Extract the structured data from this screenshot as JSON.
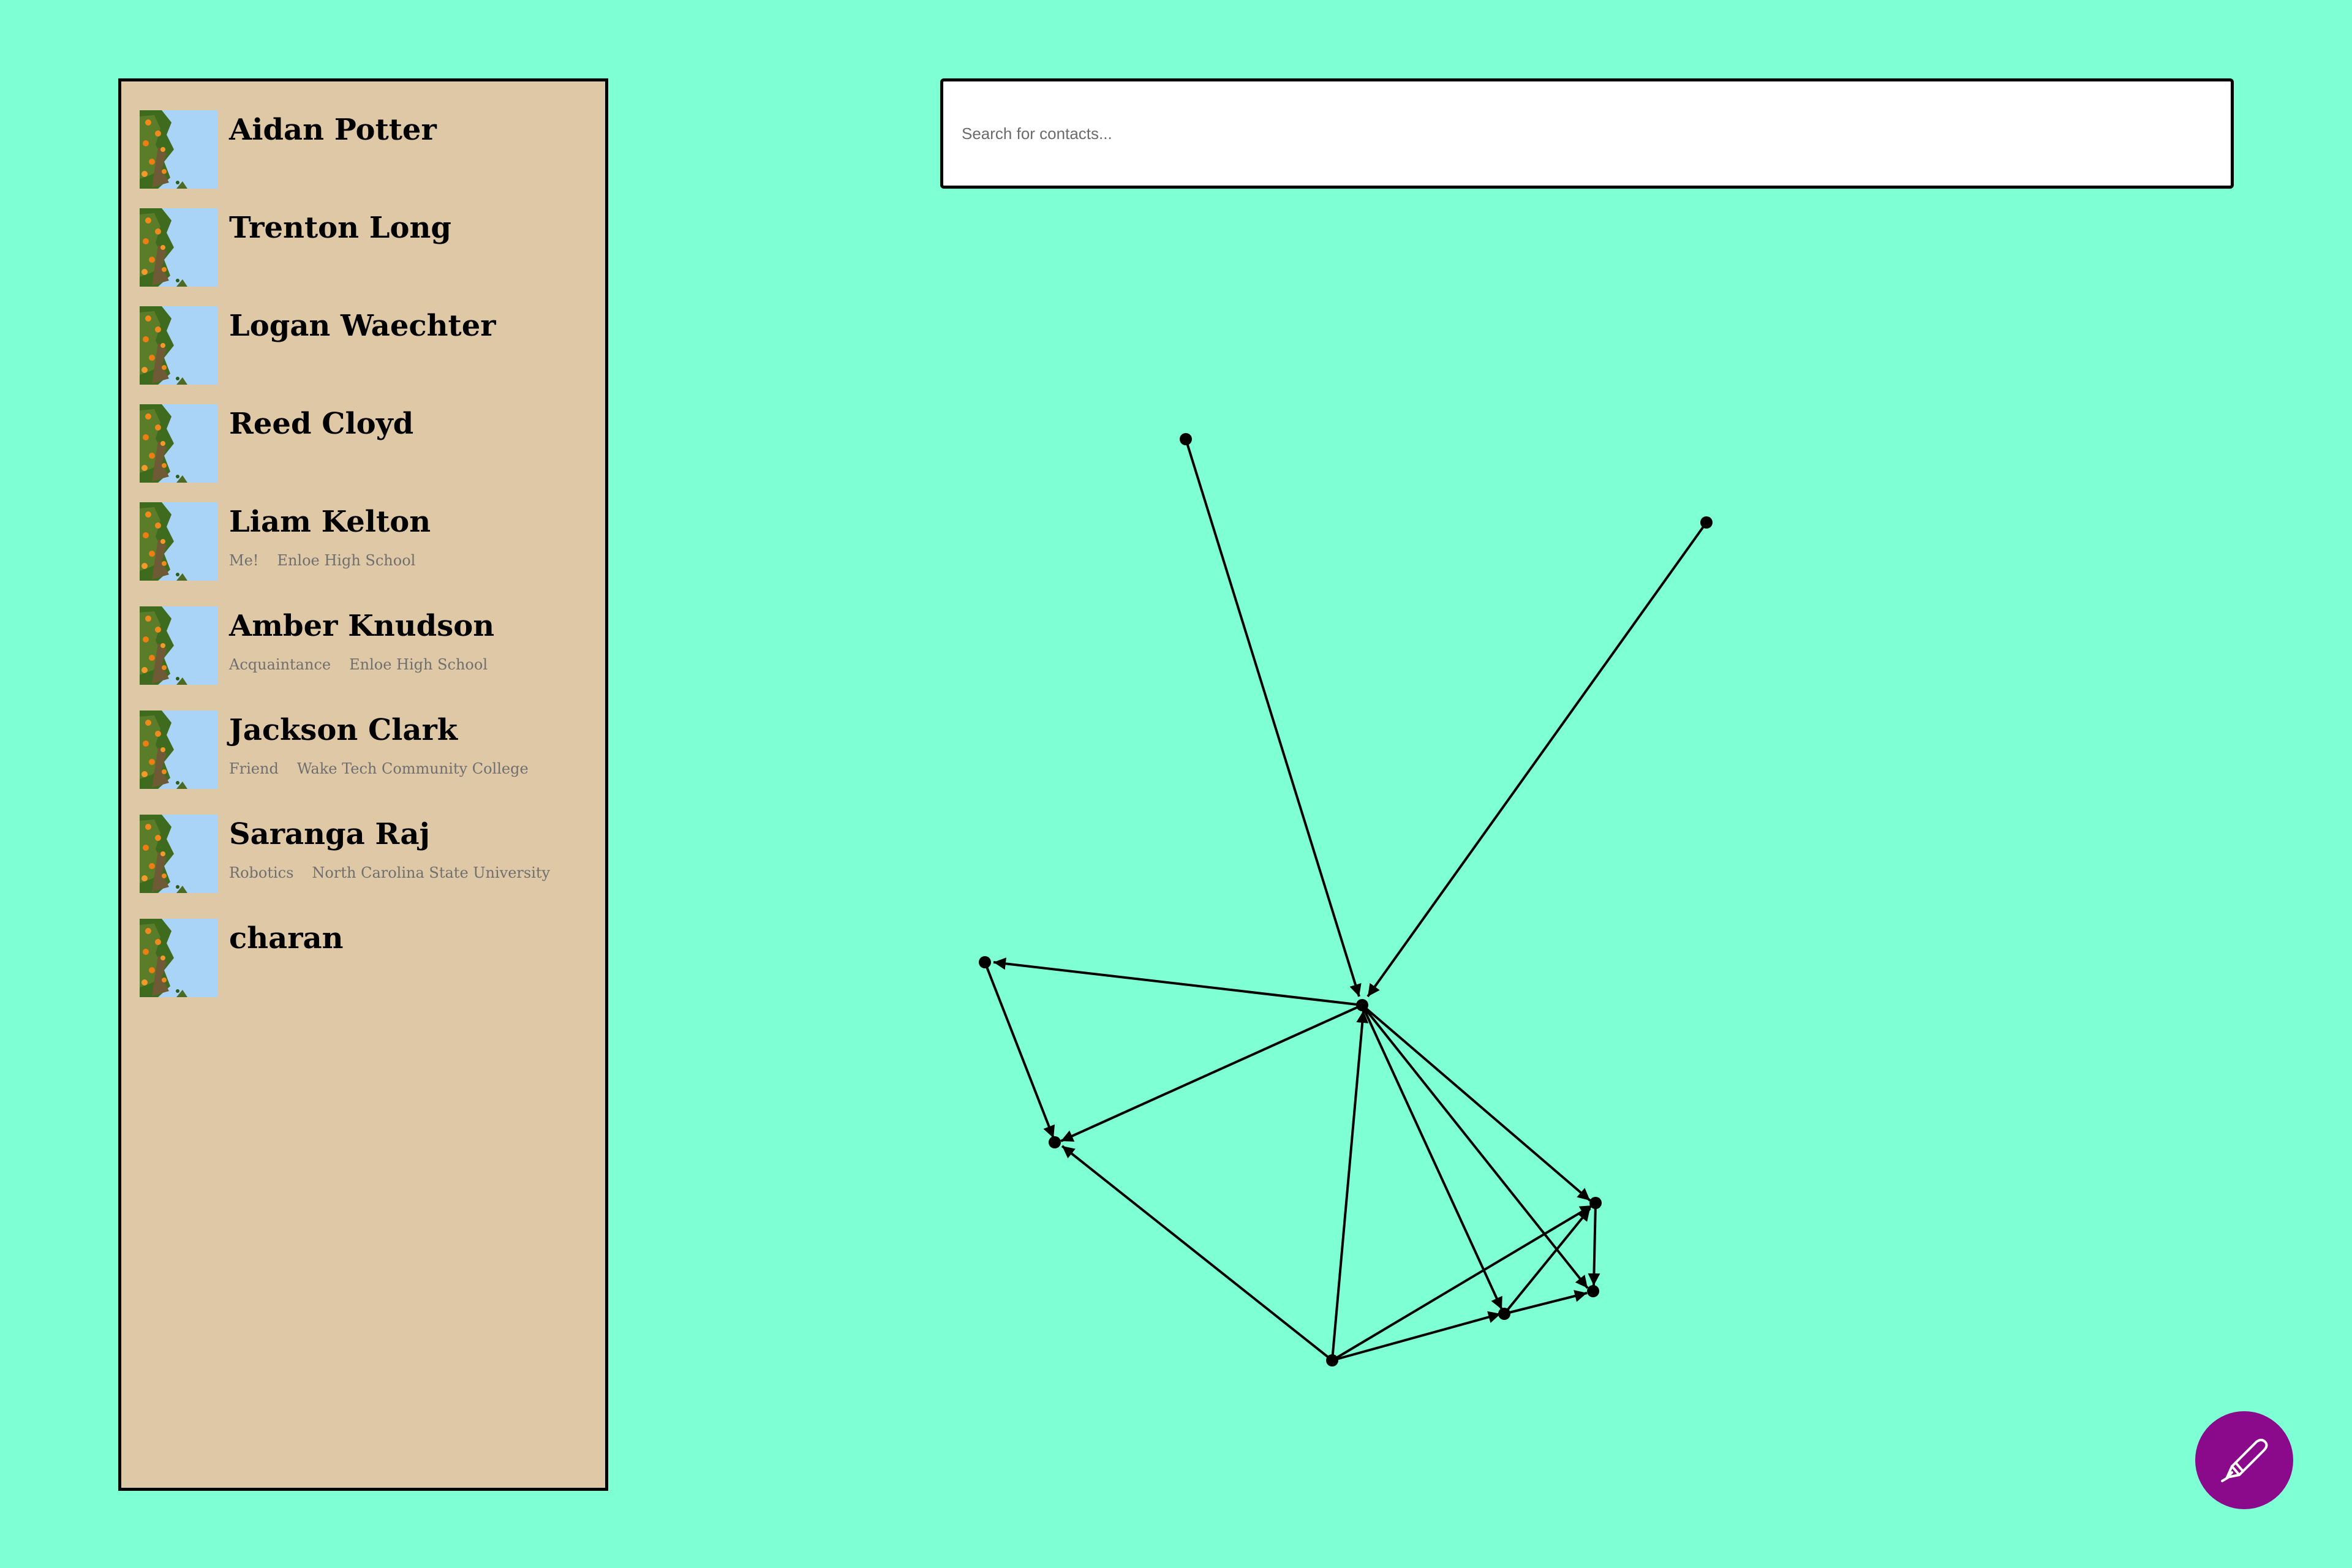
{
  "search": {
    "placeholder": "Search for contacts..."
  },
  "colors": {
    "background": "#7fffd4",
    "sidebar": "#dfc8a6",
    "fab": "#8b0a8b"
  },
  "contacts": [
    {
      "name": "Aidan Potter",
      "relation": "",
      "organization": ""
    },
    {
      "name": "Trenton Long",
      "relation": "",
      "organization": ""
    },
    {
      "name": "Logan Waechter",
      "relation": "",
      "organization": ""
    },
    {
      "name": "Reed Cloyd",
      "relation": "",
      "organization": ""
    },
    {
      "name": "Liam Kelton",
      "relation": "Me!",
      "organization": "Enloe High School"
    },
    {
      "name": "Amber Knudson",
      "relation": "Acquaintance",
      "organization": "Enloe High School"
    },
    {
      "name": "Jackson Clark",
      "relation": "Friend",
      "organization": "Wake Tech Community College"
    },
    {
      "name": "Saranga Raj",
      "relation": "Robotics",
      "organization": "North Carolina State University"
    },
    {
      "name": "charan",
      "relation": "",
      "organization": ""
    }
  ],
  "fab": {
    "icon": "pen-icon"
  }
}
